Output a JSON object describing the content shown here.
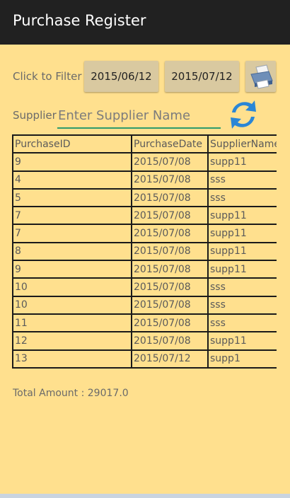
{
  "app": {
    "title": "Purchase Register"
  },
  "filter": {
    "label": "Click to Filter",
    "from_date": "2015/06/12",
    "to_date": "2015/07/12",
    "print_icon": "printer-icon"
  },
  "supplier": {
    "label": "Supplier",
    "placeholder": "Enter Supplier Name",
    "value": "",
    "refresh_icon": "refresh-icon"
  },
  "table": {
    "columns": [
      "PurchaseID",
      "PurchaseDate",
      "SupplierName"
    ],
    "rows": [
      [
        "9",
        "2015/07/08",
        "supp11"
      ],
      [
        "4",
        "2015/07/08",
        "sss"
      ],
      [
        "5",
        "2015/07/08",
        "sss"
      ],
      [
        "7",
        "2015/07/08",
        "supp11"
      ],
      [
        "7",
        "2015/07/08",
        "supp11"
      ],
      [
        "8",
        "2015/07/08",
        "supp11"
      ],
      [
        "9",
        "2015/07/08",
        "supp11"
      ],
      [
        "10",
        "2015/07/08",
        "sss"
      ],
      [
        "10",
        "2015/07/08",
        "sss"
      ],
      [
        "11",
        "2015/07/08",
        "sss"
      ],
      [
        "12",
        "2015/07/08",
        "supp11"
      ],
      [
        "13",
        "2015/07/12",
        "supp1"
      ]
    ]
  },
  "total": {
    "text": "Total Amount : 29017.0"
  },
  "colors": {
    "background": "#FFE08E",
    "titlebar": "#212121",
    "button": "#D9C9A0",
    "input_underline": "#2e9b6c",
    "refresh": "#2a86d6"
  }
}
